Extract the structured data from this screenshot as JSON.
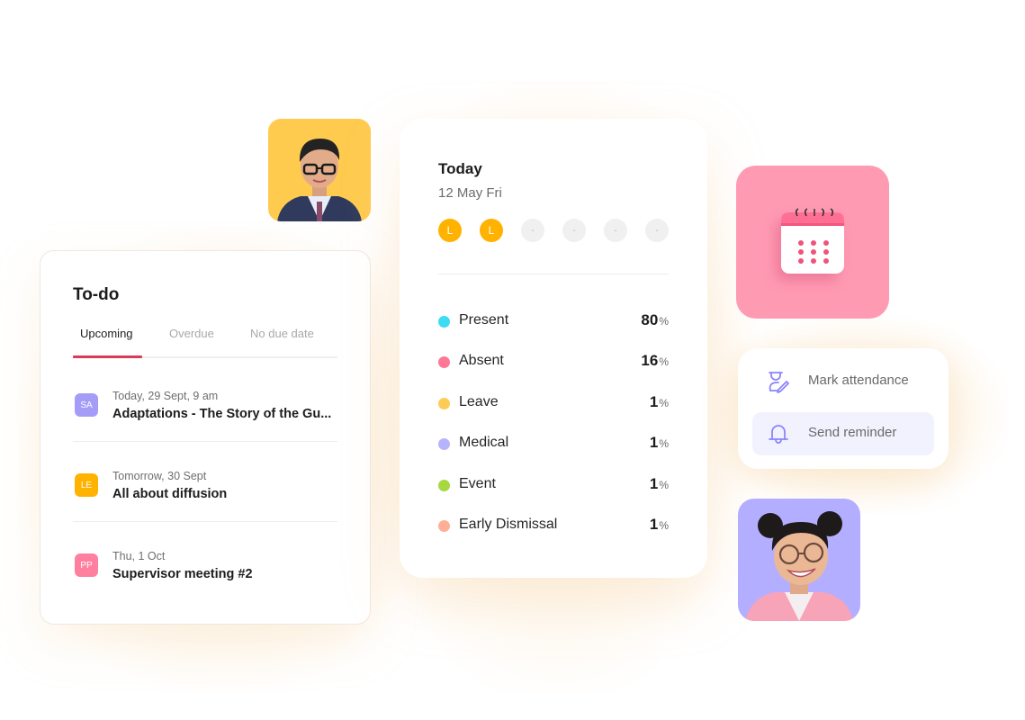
{
  "todo": {
    "title": "To-do",
    "tabs": [
      {
        "label": "Upcoming",
        "active": true
      },
      {
        "label": "Overdue",
        "active": false
      },
      {
        "label": "No due date",
        "active": false
      }
    ],
    "items": [
      {
        "initials": "SA",
        "color": "#a59cf7",
        "when": "Today, 29 Sept, 9 am",
        "title": "Adaptations - The Story of the Gu..."
      },
      {
        "initials": "LE",
        "color": "#ffb300",
        "when": "Tomorrow, 30 Sept",
        "title": "All about diffusion"
      },
      {
        "initials": "PP",
        "color": "#ff7f9e",
        "when": "Thu, 1 Oct",
        "title": "Supervisor meeting #2"
      }
    ]
  },
  "attendance": {
    "title": "Today",
    "date": "12 May Fri",
    "periods": [
      "L",
      "L",
      "-",
      "-",
      "-",
      "-"
    ],
    "stats": [
      {
        "label": "Present",
        "value": "80",
        "unit": "%",
        "color": "#3ddcf2"
      },
      {
        "label": "Absent",
        "value": "16",
        "unit": "%",
        "color": "#ff7796"
      },
      {
        "label": "Leave",
        "value": "1",
        "unit": "%",
        "color": "#ffcb57"
      },
      {
        "label": "Medical",
        "value": "1",
        "unit": "%",
        "color": "#b7b4ff"
      },
      {
        "label": "Event",
        "value": "1",
        "unit": "%",
        "color": "#a5d93f"
      },
      {
        "label": "Early Dismissal",
        "value": "1",
        "unit": "%",
        "color": "#ffb094"
      }
    ]
  },
  "actions": [
    {
      "label": "Mark attendance",
      "icon": "mark-attendance-icon"
    },
    {
      "label": "Send reminder",
      "icon": "bell-icon"
    }
  ],
  "colors": {
    "accent": "#dc3a5a",
    "icon": "#8b84ff",
    "calendar_tile": "#ff9ab3",
    "student_bg": "#fecb4f",
    "teacher_bg": "#b3aeff"
  }
}
